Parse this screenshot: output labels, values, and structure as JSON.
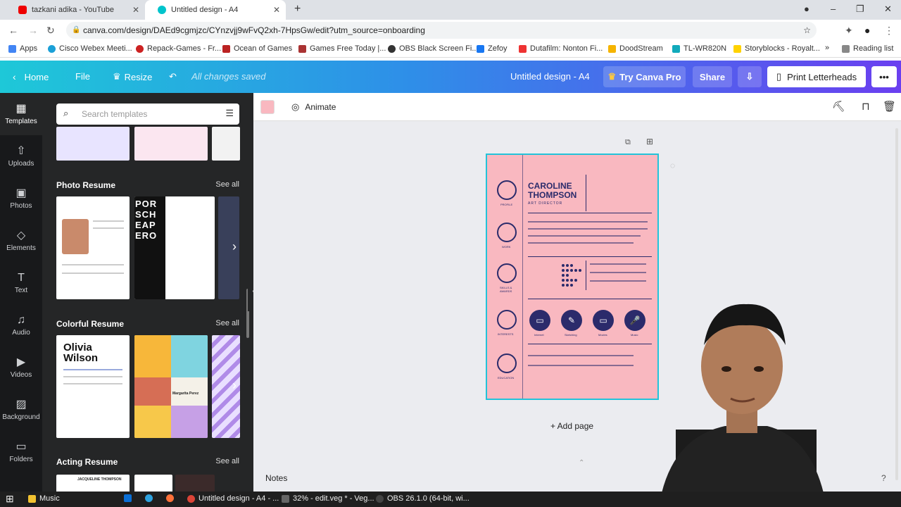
{
  "browser": {
    "tabs": [
      {
        "title": "tazkani adika - YouTube",
        "active": false
      },
      {
        "title": "Untitled design - A4",
        "active": true
      }
    ],
    "new_tab": "+",
    "url": "canva.com/design/DAEd9cgmjzc/CYnzvjj9wFvQ2xh-7HpsGw/edit?utm_source=onboarding",
    "bookmarks": [
      "Apps",
      "Cisco Webex Meeti...",
      "Repack-Games - Fr...",
      "Ocean of Games",
      "Games Free Today |...",
      "OBS Black Screen Fi...",
      "Zefoy",
      "Dutafilm: Nonton Fi...",
      "DoodStream",
      "TL-WR820N",
      "Storyblocks - Royalt..."
    ],
    "reading_list": "Reading list"
  },
  "header": {
    "home": "Home",
    "file": "File",
    "resize": "Resize",
    "saved": "All changes saved",
    "design_title": "Untitled design - A4",
    "try_pro": "Try Canva Pro",
    "share": "Share",
    "print": "Print Letterheads",
    "more": "•••"
  },
  "rail": [
    {
      "label": "Templates",
      "icon": "▦"
    },
    {
      "label": "Uploads",
      "icon": "⇧"
    },
    {
      "label": "Photos",
      "icon": "▣"
    },
    {
      "label": "Elements",
      "icon": "◇"
    },
    {
      "label": "Text",
      "icon": "T"
    },
    {
      "label": "Audio",
      "icon": "♫"
    },
    {
      "label": "Videos",
      "icon": "▶"
    },
    {
      "label": "Background",
      "icon": "▨"
    },
    {
      "label": "Folders",
      "icon": "▭"
    }
  ],
  "panel": {
    "search_placeholder": "Search templates",
    "sections": [
      {
        "title": "Photo Resume",
        "see_all": "See all"
      },
      {
        "title": "Colorful Resume",
        "see_all": "See all"
      },
      {
        "title": "Acting Resume",
        "see_all": "See all"
      }
    ],
    "thumb_texts": {
      "olivia": "Olivia Wilson",
      "porsch": "POR SCH EAP ERO",
      "margarita": "Margarita Perez",
      "jacqueline": "JACQUELINE THOMPSON"
    }
  },
  "editor": {
    "animate": "Animate",
    "add_page": "+ Add page",
    "notes": "Notes",
    "resume": {
      "name1": "CAROLINE",
      "name2": "THOMPSON",
      "role": "ART DIRECTOR",
      "sections": [
        "PROFILE",
        "WORK",
        "SKILLS & AWARDS",
        "INTERESTS",
        "EDUCATION"
      ],
      "interests": [
        "Internet",
        "Sketching",
        "Movies",
        "Music"
      ]
    }
  },
  "taskbar": {
    "items": [
      "Music",
      "Untitled design - A4 - ...",
      "32% - edit.veg * - Veg...",
      "OBS 26.1.0 (64-bit, wi..."
    ]
  },
  "colors": {
    "page_bg": "#f9b8c0",
    "ink": "#2b2b6b",
    "selection": "#23c3d9",
    "pro_button": "#7d2ae8"
  }
}
